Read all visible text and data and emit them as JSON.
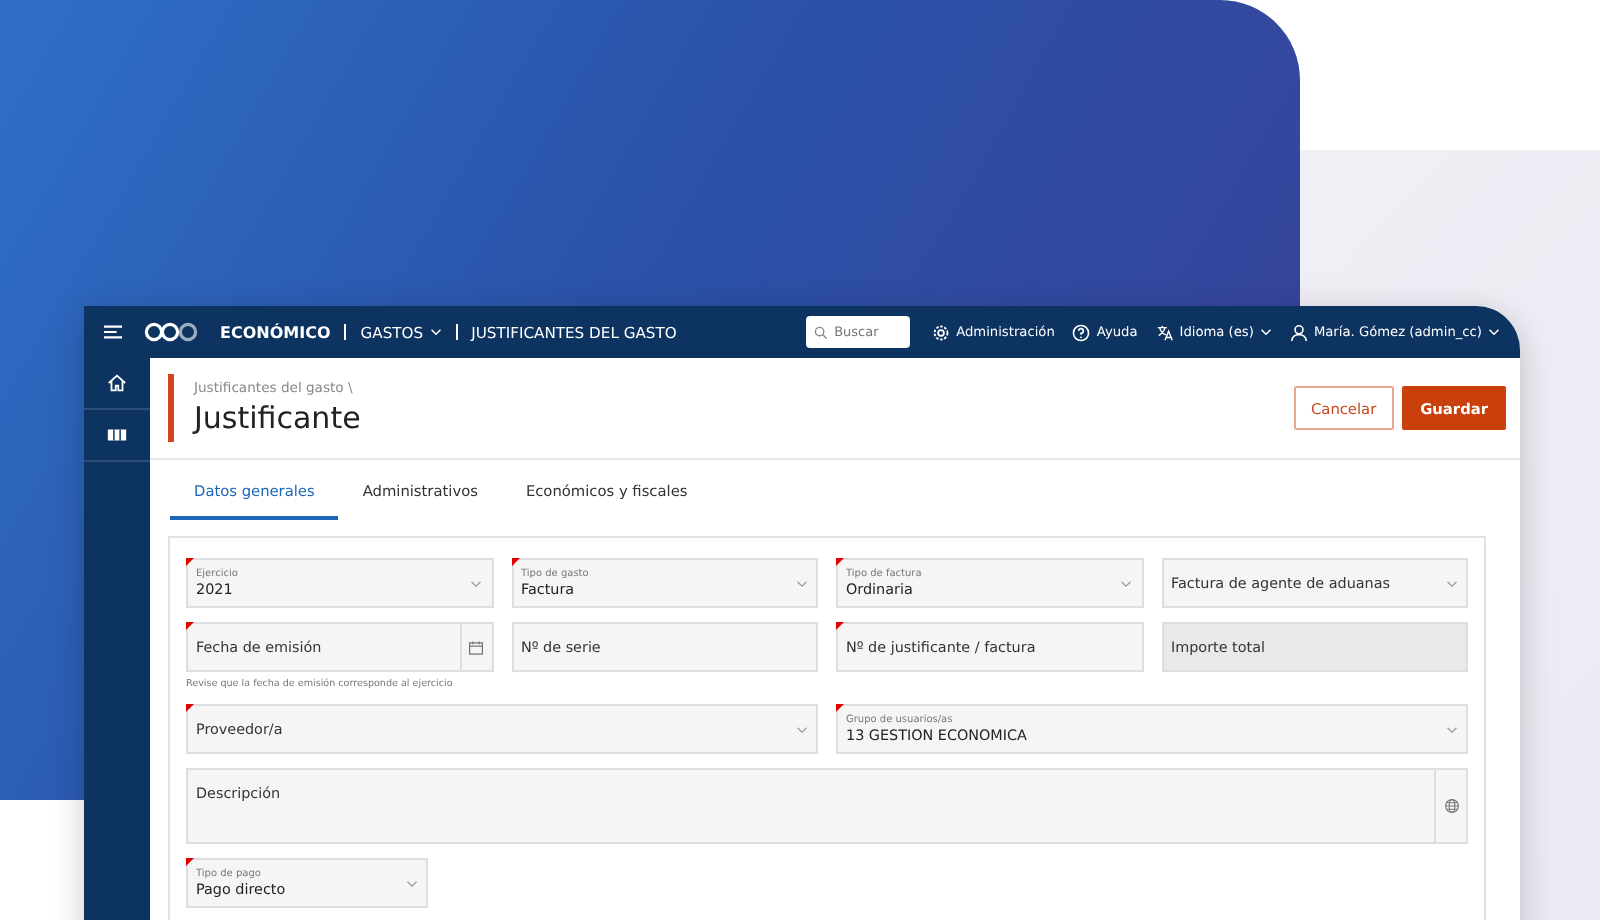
{
  "topbar": {
    "module": "ECONÓMICO",
    "crumbs": [
      {
        "label": "GASTOS",
        "dropdown": true
      },
      {
        "label": "JUSTIFICANTES DEL GASTO",
        "dropdown": false
      }
    ],
    "search": {
      "placeholder": "Buscar"
    },
    "links": [
      {
        "kind": "settings",
        "label": "Administración",
        "dropdown": false
      },
      {
        "kind": "help",
        "label": "Ayuda",
        "dropdown": false
      },
      {
        "kind": "language",
        "label": "Idioma (es)",
        "dropdown": true
      },
      {
        "kind": "user",
        "label": "María. Gómez (admin_cc)",
        "dropdown": true
      }
    ]
  },
  "sidebar": {
    "items": [
      {
        "kind": "home",
        "selected": false
      },
      {
        "kind": "book",
        "selected": false
      }
    ]
  },
  "page": {
    "breadcrumb": "Justificantes del gasto \\",
    "title": "Justificante",
    "buttons": [
      {
        "kind": "secondary",
        "label": "Cancelar"
      },
      {
        "kind": "primary",
        "label": "Guardar"
      }
    ]
  },
  "tabs": [
    {
      "label": "Datos generales",
      "selected": true
    },
    {
      "label": "Administrativos",
      "selected": false
    },
    {
      "label": "Económicos y fiscales",
      "selected": false
    }
  ],
  "rows": [
    {
      "fields": [
        {
          "kind": "select",
          "label": "Ejercicio",
          "value": "2021",
          "required": true,
          "disabled": false
        },
        {
          "kind": "select",
          "label": "Tipo de gasto",
          "value": "Factura",
          "required": true,
          "disabled": false
        },
        {
          "kind": "select",
          "label": "Tipo de factura",
          "value": "Ordinaria",
          "required": true,
          "disabled": false
        },
        {
          "kind": "select",
          "placeholder": "Factura de agente de aduanas",
          "required": false,
          "disabled": false
        }
      ]
    },
    {
      "fields": [
        {
          "kind": "date",
          "placeholder": "Fecha de emisión",
          "required": true,
          "disabled": false,
          "hint": "Revise que la fecha de emisión corresponde al ejercicio"
        },
        {
          "kind": "text",
          "placeholder": "Nº de serie",
          "required": false,
          "disabled": false
        },
        {
          "kind": "text",
          "placeholder": "Nº de justificante / factura",
          "required": true,
          "disabled": false
        },
        {
          "kind": "text",
          "placeholder": "Importe total",
          "required": false,
          "disabled": true
        }
      ]
    },
    {
      "fields": [
        {
          "kind": "select",
          "placeholder": "Proveedor/a",
          "required": true,
          "disabled": false
        },
        {
          "kind": "select",
          "label": "Grupo de usuarios/as",
          "value": "13 GESTION ECONOMICA",
          "required": true,
          "disabled": false
        }
      ]
    },
    {
      "fields": [
        {
          "kind": "textarea",
          "placeholder": "Descripción",
          "required": false,
          "disabled": false
        }
      ]
    },
    {
      "fields": [
        {
          "kind": "select",
          "label": "Tipo de pago",
          "value": "Pago directo",
          "required": true,
          "disabled": false
        }
      ]
    }
  ]
}
